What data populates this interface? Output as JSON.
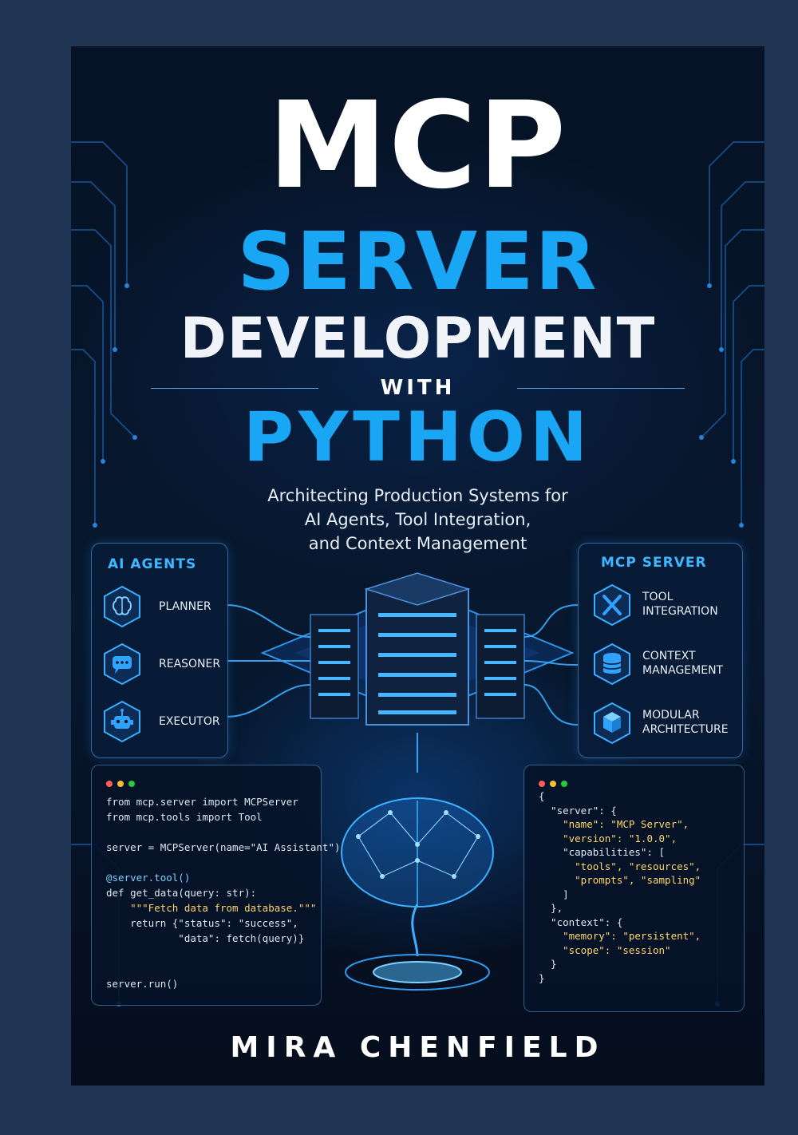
{
  "book": {
    "title_line1": "MCP",
    "title_line2": "SERVER",
    "title_line3": "DEVELOPMENT",
    "title_connector": "WITH",
    "title_line4": "PYTHON",
    "subtitle_lines": [
      "Architecting Production Systems for",
      "AI Agents, Tool Integration,",
      "and Context Management"
    ],
    "author": "MIRA CHENFIELD"
  },
  "left_panel": {
    "title": "AI AGENTS",
    "items": [
      {
        "label": "PLANNER",
        "icon": "brain-icon"
      },
      {
        "label": "REASONER",
        "icon": "chat-bubble-icon"
      },
      {
        "label": "EXECUTOR",
        "icon": "robot-icon"
      }
    ]
  },
  "right_panel": {
    "title": "MCP SERVER",
    "items": [
      {
        "label_line1": "TOOL",
        "label_line2": "INTEGRATION",
        "icon": "tools-icon"
      },
      {
        "label_line1": "CONTEXT",
        "label_line2": "MANAGEMENT",
        "icon": "database-icon"
      },
      {
        "label_line1": "MODULAR",
        "label_line2": "ARCHITECTURE",
        "icon": "cube-icon"
      }
    ]
  },
  "python_code": [
    "from mcp.server import MCPServer",
    "from mcp.tools import Tool",
    "",
    "server = MCPServer(name=\"AI Assistant\")",
    "",
    "@server.tool()",
    "def get_data(query: str):",
    "    \"\"\"Fetch data from database.\"\"\"",
    "    return {\"status\": \"success\",",
    "            \"data\": fetch(query)}",
    "",
    "",
    "server.run()"
  ],
  "json_code": [
    "{",
    "  \"server\": {",
    "    \"name\": \"MCP Server\",",
    "    \"version\": \"1.0.0\",",
    "    \"capabilities\": [",
    "      \"tools\", \"resources\",",
    "      \"prompts\", \"sampling\"",
    "    ]",
    "  },",
    "  \"context\": {",
    "    \"memory\": \"persistent\",",
    "    \"scope\": \"session\"",
    "  }",
    "}"
  ],
  "colors": {
    "accent_blue": "#19a6f5",
    "title_white": "#ffffff",
    "window_dots": [
      "#ff5f56",
      "#ffbd2e",
      "#27c93f"
    ]
  }
}
